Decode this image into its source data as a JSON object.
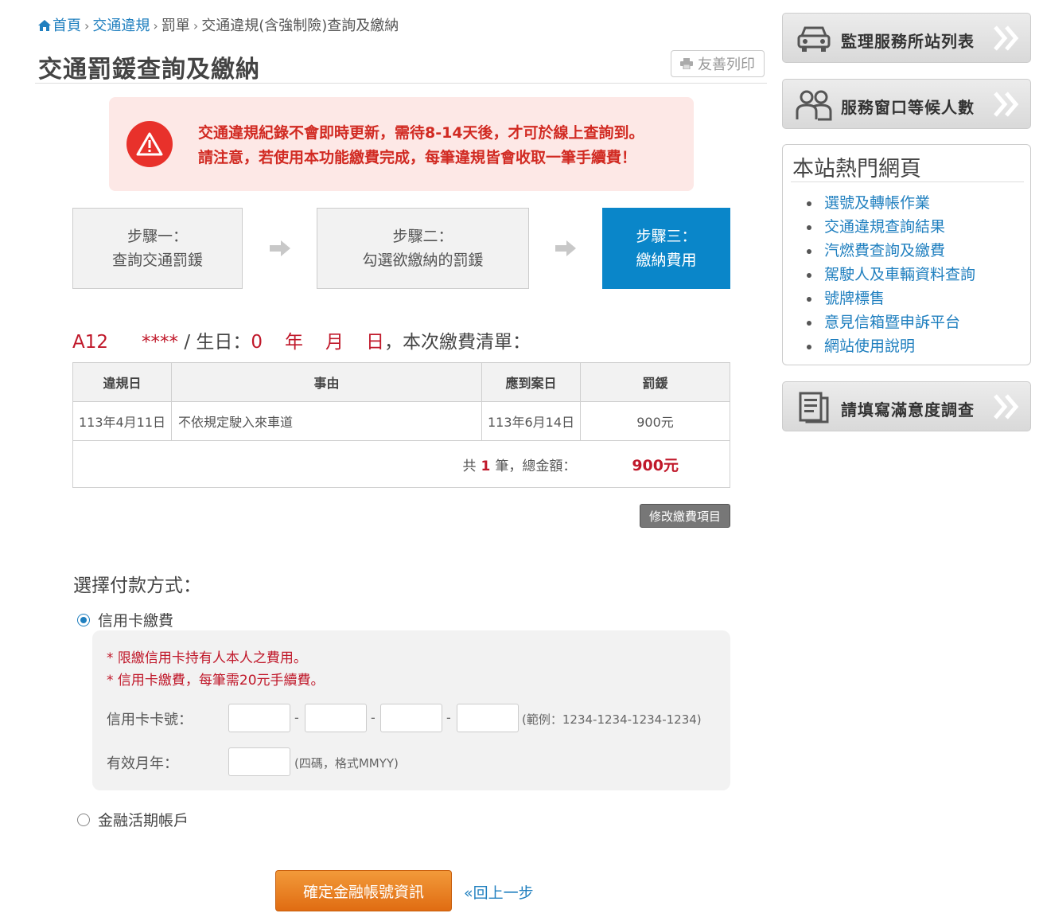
{
  "breadcrumb": {
    "home": "首頁",
    "level1": "交通違規",
    "level2": "罰單",
    "current": "交通違規(含強制險)查詢及繳納"
  },
  "page": {
    "title": "交通罰鍰查詢及繳納",
    "print_label": "友善列印"
  },
  "notice": {
    "line1": "交通違規紀錄不會即時更新，需待8-14天後，才可於線上查詢到。",
    "line2": "請注意，若使用本功能繳費完成，每筆違規皆會收取一筆手續費！"
  },
  "steps": [
    {
      "title": "步驟一：",
      "desc": "查詢交通罰鍰"
    },
    {
      "title": "步驟二：",
      "desc": "勾選欲繳納的罰鍰"
    },
    {
      "title": "步驟三：",
      "desc": "繳納費用"
    }
  ],
  "summary": {
    "id_prefix": "A12",
    "id_masked": "****",
    "birth_label": "/ 生日：",
    "birth_year": "0",
    "year_label": "年",
    "month_label": "月",
    "day_label": "日",
    "suffix": "，本次繳費清單："
  },
  "table": {
    "headers": [
      "違規日",
      "事由",
      "應到案日",
      "罰鍰"
    ],
    "rows": [
      {
        "date": "113年4月11日",
        "reason": "不依規定駛入來車道",
        "due": "113年6月14日",
        "fine": "900元"
      }
    ],
    "total_prefix": "共",
    "total_count": "1",
    "total_mid": "筆，總金額：",
    "total_amount": "900元"
  },
  "modify_label": "修改繳費項目",
  "payment": {
    "title": "選擇付款方式：",
    "credit_label": "信用卡繳費",
    "note1": "* 限繳信用卡持有人本人之費用。",
    "note2": "* 信用卡繳費，每筆需20元手續費。",
    "card_label": "信用卡卡號：",
    "card_hint": "(範例：1234-1234-1234-1234)",
    "expiry_label": "有效月年：",
    "expiry_hint": "(四碼，格式MMYY)",
    "bank_label": "金融活期帳戶"
  },
  "actions": {
    "confirm": "確定金融帳號資訊",
    "back": "«回上一步"
  },
  "sidebar": {
    "btn1": "監理服務所站列表",
    "btn2": "服務窗口等候人數",
    "hot_title": "本站熱門網頁",
    "hot_links": [
      "選號及轉帳作業",
      "交通違規查詢結果",
      "汽燃費查詢及繳費",
      "駕駛人及車輛資料查詢",
      "號牌標售",
      "意見信箱暨申訴平台",
      "網站使用說明"
    ],
    "btn3": "請填寫滿意度調查"
  },
  "colors": {
    "link": "#1f7fbf",
    "alert_red": "#d12a22",
    "active_step": "#0a86c9",
    "confirm_orange": "#e06c12"
  }
}
